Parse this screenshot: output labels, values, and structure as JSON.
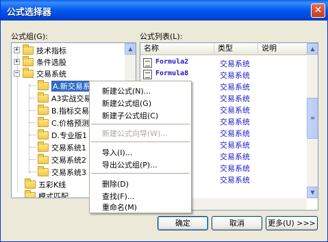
{
  "window": {
    "title": "公式选择器",
    "close_glyph": "✕"
  },
  "left_label": "公式组(G):",
  "right_label": "公式列表(L):",
  "tree": {
    "items": [
      {
        "label": "技术指标",
        "expander": "+"
      },
      {
        "label": "条件选股",
        "expander": "+"
      },
      {
        "label": "交易系统",
        "expander": "−"
      },
      {
        "label": "A.新交易系"
      },
      {
        "label": "A3实战交易"
      },
      {
        "label": "B.指标交易"
      },
      {
        "label": "C.价格预测"
      },
      {
        "label": "D.专业版1"
      },
      {
        "label": "交易系统1"
      },
      {
        "label": "交易系统2"
      },
      {
        "label": "交易系统3"
      },
      {
        "label": "五彩K线"
      },
      {
        "label": "模式匹配"
      }
    ]
  },
  "list": {
    "columns": [
      "名称",
      "类型",
      "说明"
    ],
    "rows": [
      {
        "name": "Formula2",
        "type": "交易系统"
      },
      {
        "name": "Formula8",
        "type": "交易系统"
      },
      {
        "name": "",
        "type": "交易系统"
      },
      {
        "name": "",
        "type": "交易系统"
      },
      {
        "name": "",
        "type": "交易系统"
      },
      {
        "name": "",
        "type": "交易系统"
      },
      {
        "name": "",
        "type": "交易系统"
      },
      {
        "name": "",
        "type": "交易系统"
      },
      {
        "name": "",
        "type": "交易系统"
      },
      {
        "name": "",
        "type": "交易系统"
      },
      {
        "name": "",
        "type": "交易系统"
      }
    ]
  },
  "context_menu": {
    "items": [
      {
        "label": "新建公式(N)...",
        "disabled": false
      },
      {
        "label": "新建公式组(G)",
        "disabled": false
      },
      {
        "label": "新建子公式组(C)",
        "disabled": false
      },
      {
        "separator": true
      },
      {
        "label": "新建公式向导(W)...",
        "disabled": true
      },
      {
        "separator": true
      },
      {
        "label": "导入(I)...",
        "disabled": false
      },
      {
        "label": "导出公式组(P)...",
        "disabled": false
      },
      {
        "separator": true
      },
      {
        "label": "删除(D)",
        "disabled": false
      },
      {
        "label": "查找(F)...",
        "disabled": false
      },
      {
        "label": "重命名(M)",
        "disabled": false
      }
    ]
  },
  "buttons": {
    "ok": "确定",
    "cancel": "取消",
    "more": "更多(U) >>>"
  },
  "colors": {
    "title_bar": "#0058ee",
    "selection": "#316ac5",
    "formula_text": "#1a1ac8"
  }
}
